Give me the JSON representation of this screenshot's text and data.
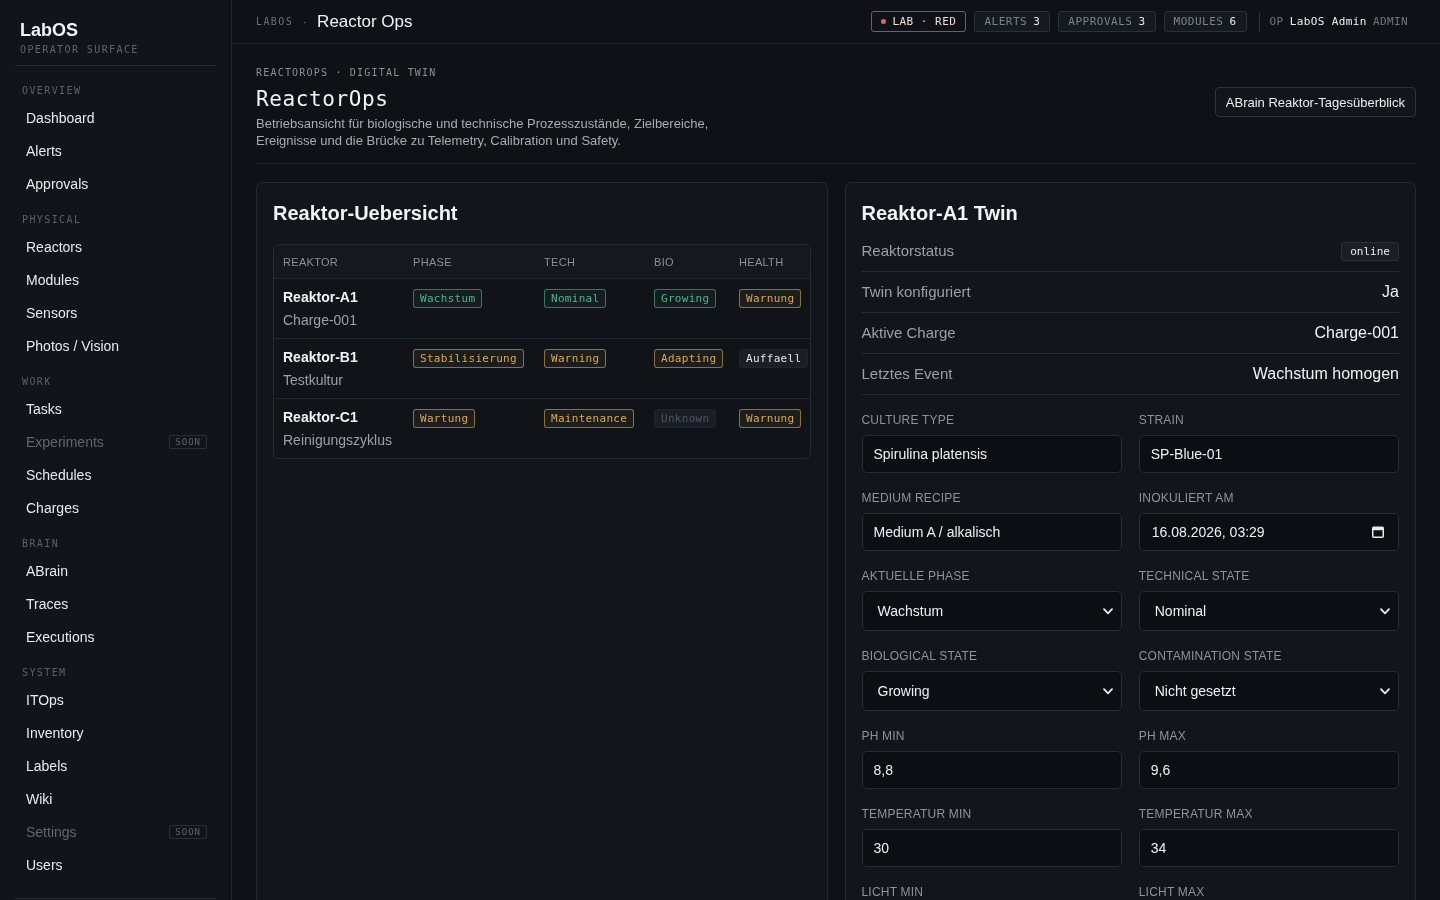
{
  "sidebar": {
    "brand": "LabOS",
    "tagline": "OPERATOR SURFACE",
    "sections": [
      {
        "title": "OVERVIEW",
        "items": [
          {
            "label": "Dashboard",
            "disabled": false
          },
          {
            "label": "Alerts",
            "disabled": false
          },
          {
            "label": "Approvals",
            "disabled": false
          }
        ]
      },
      {
        "title": "PHYSICAL",
        "items": [
          {
            "label": "Reactors",
            "disabled": false
          },
          {
            "label": "Modules",
            "disabled": false
          },
          {
            "label": "Sensors",
            "disabled": false
          },
          {
            "label": "Photos / Vision",
            "disabled": false
          }
        ]
      },
      {
        "title": "WORK",
        "items": [
          {
            "label": "Tasks",
            "disabled": false
          },
          {
            "label": "Experiments",
            "disabled": true,
            "badge": "SOON"
          },
          {
            "label": "Schedules",
            "disabled": false
          },
          {
            "label": "Charges",
            "disabled": false
          }
        ]
      },
      {
        "title": "BRAIN",
        "items": [
          {
            "label": "ABrain",
            "disabled": false
          },
          {
            "label": "Traces",
            "disabled": false
          },
          {
            "label": "Executions",
            "disabled": false
          }
        ]
      },
      {
        "title": "SYSTEM",
        "items": [
          {
            "label": "ITOps",
            "disabled": false
          },
          {
            "label": "Inventory",
            "disabled": false
          },
          {
            "label": "Labels",
            "disabled": false
          },
          {
            "label": "Wiki",
            "disabled": false
          },
          {
            "label": "Settings",
            "disabled": true,
            "badge": "SOON"
          },
          {
            "label": "Users",
            "disabled": false
          }
        ]
      }
    ]
  },
  "topbar": {
    "breadcrumb": {
      "section": "LABOS",
      "separator": "·",
      "page": "Reactor Ops"
    },
    "environment": {
      "label": "LAB · RED",
      "color": "#e0675d"
    },
    "counters": [
      {
        "label": "ALERTS",
        "count": "3"
      },
      {
        "label": "APPROVALS",
        "count": "3"
      },
      {
        "label": "MODULES",
        "count": "6"
      }
    ],
    "user": {
      "prefix": "OP",
      "name": "LabOS Admin",
      "role": "ADMIN"
    }
  },
  "header": {
    "eyebrow": "REACTOROPS · DIGITAL TWIN",
    "title": "ReactorOps",
    "description": "Betriebsansicht für biologische und technische Prozesszustände, Zielbereiche, Ereignisse und die Brücke zu Telemetry, Calibration und Safety.",
    "action": "ABrain Reaktor-Tagesüberblick"
  },
  "overview": {
    "title": "Reaktor-Uebersicht",
    "table": {
      "columns": [
        "REAKTOR",
        "PHASE",
        "TECH",
        "BIO",
        "HEALTH"
      ],
      "rows": [
        {
          "cells": [
            {
              "kind": "reactor",
              "text": "Reaktor-A1",
              "subtitle": "Charge-001"
            },
            {
              "kind": "outline",
              "text": "Wachstum",
              "color": "#4fb389"
            },
            {
              "kind": "outline",
              "text": "Nominal",
              "color": "#4fb389"
            },
            {
              "kind": "outline",
              "text": "Growing",
              "color": "#4fb389"
            },
            {
              "kind": "outline",
              "text": "Warnung",
              "color": "#d9a852"
            }
          ]
        },
        {
          "cells": [
            {
              "kind": "reactor",
              "text": "Reaktor-B1",
              "subtitle": "Testkultur"
            },
            {
              "kind": "outline",
              "text": "Stabilisierung",
              "color": "#d9a852"
            },
            {
              "kind": "outline",
              "text": "Warning",
              "color": "#d9a852"
            },
            {
              "kind": "outline",
              "text": "Adapting",
              "color": "#d9a852"
            },
            {
              "kind": "filled",
              "text": "Auffaell",
              "color": "#e4e6e9"
            }
          ]
        },
        {
          "cells": [
            {
              "kind": "reactor",
              "text": "Reaktor-C1",
              "subtitle": "Reinigungszyklus"
            },
            {
              "kind": "outline",
              "text": "Wartung",
              "color": "#d9a852"
            },
            {
              "kind": "outline",
              "text": "Maintenance",
              "color": "#d9a852"
            },
            {
              "kind": "filled",
              "text": "Unknown",
              "color": "#4f5560"
            },
            {
              "kind": "outline",
              "text": "Warnung",
              "color": "#d9a852"
            }
          ]
        }
      ]
    }
  },
  "twin": {
    "title": "Reaktor-A1 Twin",
    "details": [
      {
        "label": "Reaktorstatus",
        "value": "online",
        "kind": "badge"
      },
      {
        "label": "Twin konfiguriert",
        "value": "Ja",
        "kind": "text"
      },
      {
        "label": "Aktive Charge",
        "value": "Charge-001",
        "kind": "text"
      },
      {
        "label": "Letztes Event",
        "value": "Wachstum homogen",
        "kind": "text"
      }
    ],
    "fields": [
      {
        "label": "CULTURE TYPE",
        "value": "Spirulina platensis",
        "kind": "text"
      },
      {
        "label": "STRAIN",
        "value": "SP-Blue-01",
        "kind": "text"
      },
      {
        "label": "MEDIUM RECIPE",
        "value": "Medium A / alkalisch",
        "kind": "text"
      },
      {
        "label": "INOKULIERT AM",
        "value": "16.08.2026, 03:29",
        "kind": "date"
      },
      {
        "label": "AKTUELLE PHASE",
        "value": "Wachstum",
        "kind": "select"
      },
      {
        "label": "TECHNICAL STATE",
        "value": "Nominal",
        "kind": "select"
      },
      {
        "label": "BIOLOGICAL STATE",
        "value": "Growing",
        "kind": "select"
      },
      {
        "label": "CONTAMINATION STATE",
        "value": "Nicht gesetzt",
        "kind": "select"
      },
      {
        "label": "PH MIN",
        "value": "8,8",
        "kind": "text"
      },
      {
        "label": "PH MAX",
        "value": "9,6",
        "kind": "text"
      },
      {
        "label": "TEMPERATUR MIN",
        "value": "30",
        "kind": "text"
      },
      {
        "label": "TEMPERATUR MAX",
        "value": "34",
        "kind": "text"
      },
      {
        "label": "LICHT MIN"
      },
      {
        "label": "LICHT MAX"
      }
    ]
  }
}
